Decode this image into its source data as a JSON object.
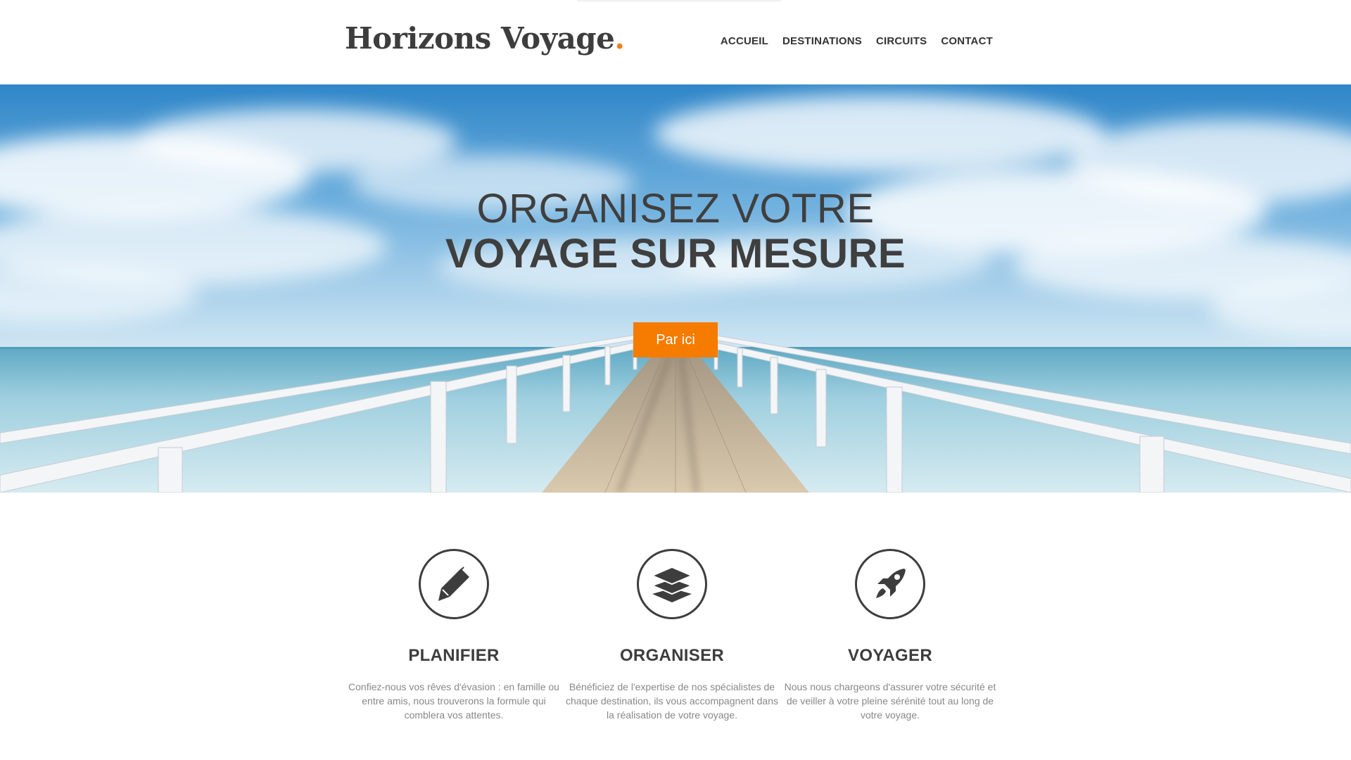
{
  "header": {
    "logo_text": "Horizons Voyage",
    "logo_dot": ".",
    "nav": [
      {
        "label": "ACCUEIL"
      },
      {
        "label": "DESTINATIONS"
      },
      {
        "label": "CIRCUITS"
      },
      {
        "label": "CONTACT"
      }
    ]
  },
  "hero": {
    "line1": "ORGANISEZ VOTRE",
    "line2": "VOYAGE SUR MESURE",
    "cta_label": "Par ici"
  },
  "features": [
    {
      "icon": "pen-icon",
      "title": "PLANIFIER",
      "text": "Confiez-nous vos rêves d'évasion : en famille ou entre amis, nous trouverons la formule qui comblera vos attentes."
    },
    {
      "icon": "layers-icon",
      "title": "ORGANISER",
      "text": "Bénéficiez de l'expertise de nos spécialistes de chaque destination, ils vous accompagnent dans la réalisation de votre voyage."
    },
    {
      "icon": "rocket-icon",
      "title": "VOYAGER",
      "text": "Nous nous chargeons d'assurer votre sécurité et de veiller à votre pleine sérénité tout au long de votre voyage."
    }
  ],
  "colors": {
    "accent": "#f57c00",
    "text_dark": "#3d3d3d",
    "text_muted": "#888888"
  }
}
